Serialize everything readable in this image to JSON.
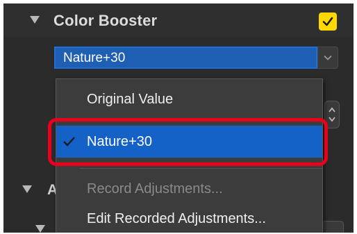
{
  "section": {
    "title": "Color Booster",
    "enabled": true
  },
  "combo": {
    "selected_value": "Nature+30"
  },
  "background": {
    "partial_section_label": "A"
  },
  "dropdown": {
    "items": [
      {
        "label": "Original Value",
        "enabled": true,
        "selected": false
      },
      {
        "label": "Nature+30",
        "enabled": true,
        "selected": true
      },
      {
        "label": "Record Adjustments...",
        "enabled": false,
        "selected": false
      },
      {
        "label": "Edit Recorded Adjustments...",
        "enabled": true,
        "selected": false
      }
    ]
  },
  "colors": {
    "panel_bg": "#2b2b2b",
    "accent_blue": "#1462c8",
    "checkbox_yellow": "#ffd800",
    "highlight_red": "#e8001c",
    "disabled_text": "#8a8a8a"
  },
  "icons": {
    "collapse": "triangle-down-icon",
    "checkbox": "checkmark-icon",
    "dropdown_arrow": "chevron-down-icon",
    "selected_marker": "checkmark-icon"
  }
}
